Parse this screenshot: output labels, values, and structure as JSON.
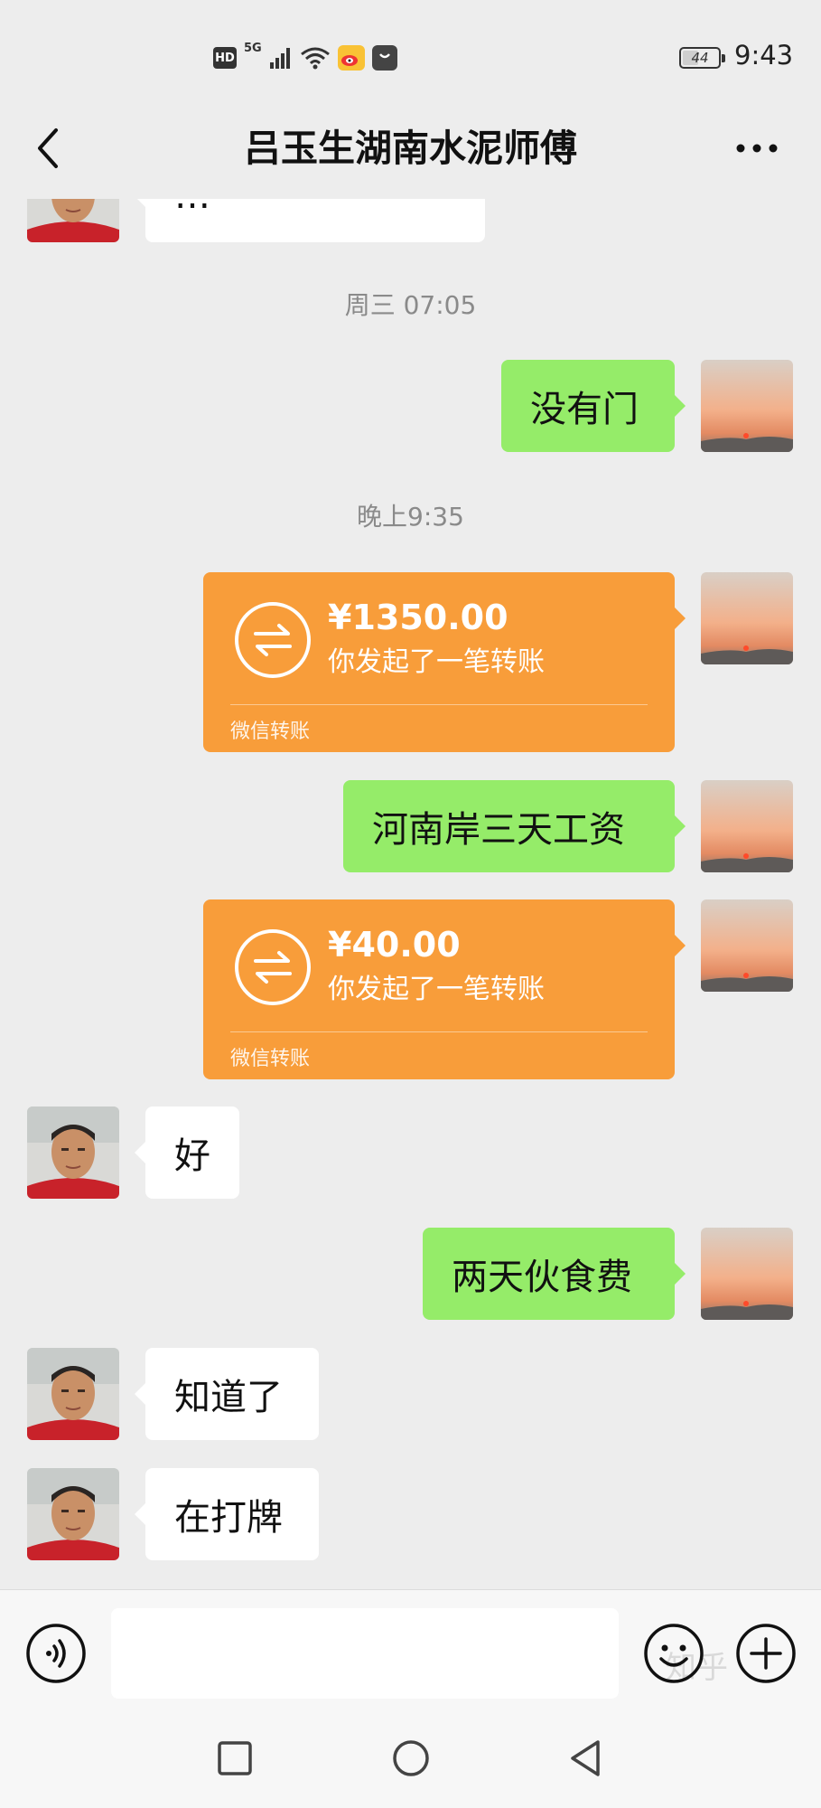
{
  "status_bar": {
    "hd": "HD",
    "network": "5G",
    "battery": "44",
    "battery_level": 0.44,
    "time": "9:43"
  },
  "header": {
    "title": "吕玉生湖南水泥师傅",
    "back_icon": "chevron-left-icon",
    "more_icon": "more-dots-icon"
  },
  "messages": {
    "m0": {
      "text": "…"
    },
    "ts1": {
      "text": "周三 07:05"
    },
    "m1": {
      "text": "没有门"
    },
    "ts2": {
      "text": "晚上9:35"
    },
    "transfer1": {
      "amount": "¥1350.00",
      "desc": "你发起了一笔转账",
      "footer": "微信转账"
    },
    "m2": {
      "text": "河南岸三天工资"
    },
    "transfer2": {
      "amount": "¥40.00",
      "desc": "你发起了一笔转账",
      "footer": "微信转账"
    },
    "m3": {
      "text": "好"
    },
    "m4": {
      "text": "两天伙食费"
    },
    "m5": {
      "text": "知道了"
    },
    "m6": {
      "text": "在打牌"
    }
  },
  "input_bar": {
    "value": "",
    "placeholder": "",
    "voice_icon": "voice-icon",
    "emoji_icon": "emoji-icon",
    "plus_icon": "plus-icon",
    "watermark": "知乎"
  },
  "colors": {
    "background": "#ededed",
    "sent_bubble": "#95ec69",
    "received_bubble": "#ffffff",
    "transfer_card": "#f89d3a"
  }
}
